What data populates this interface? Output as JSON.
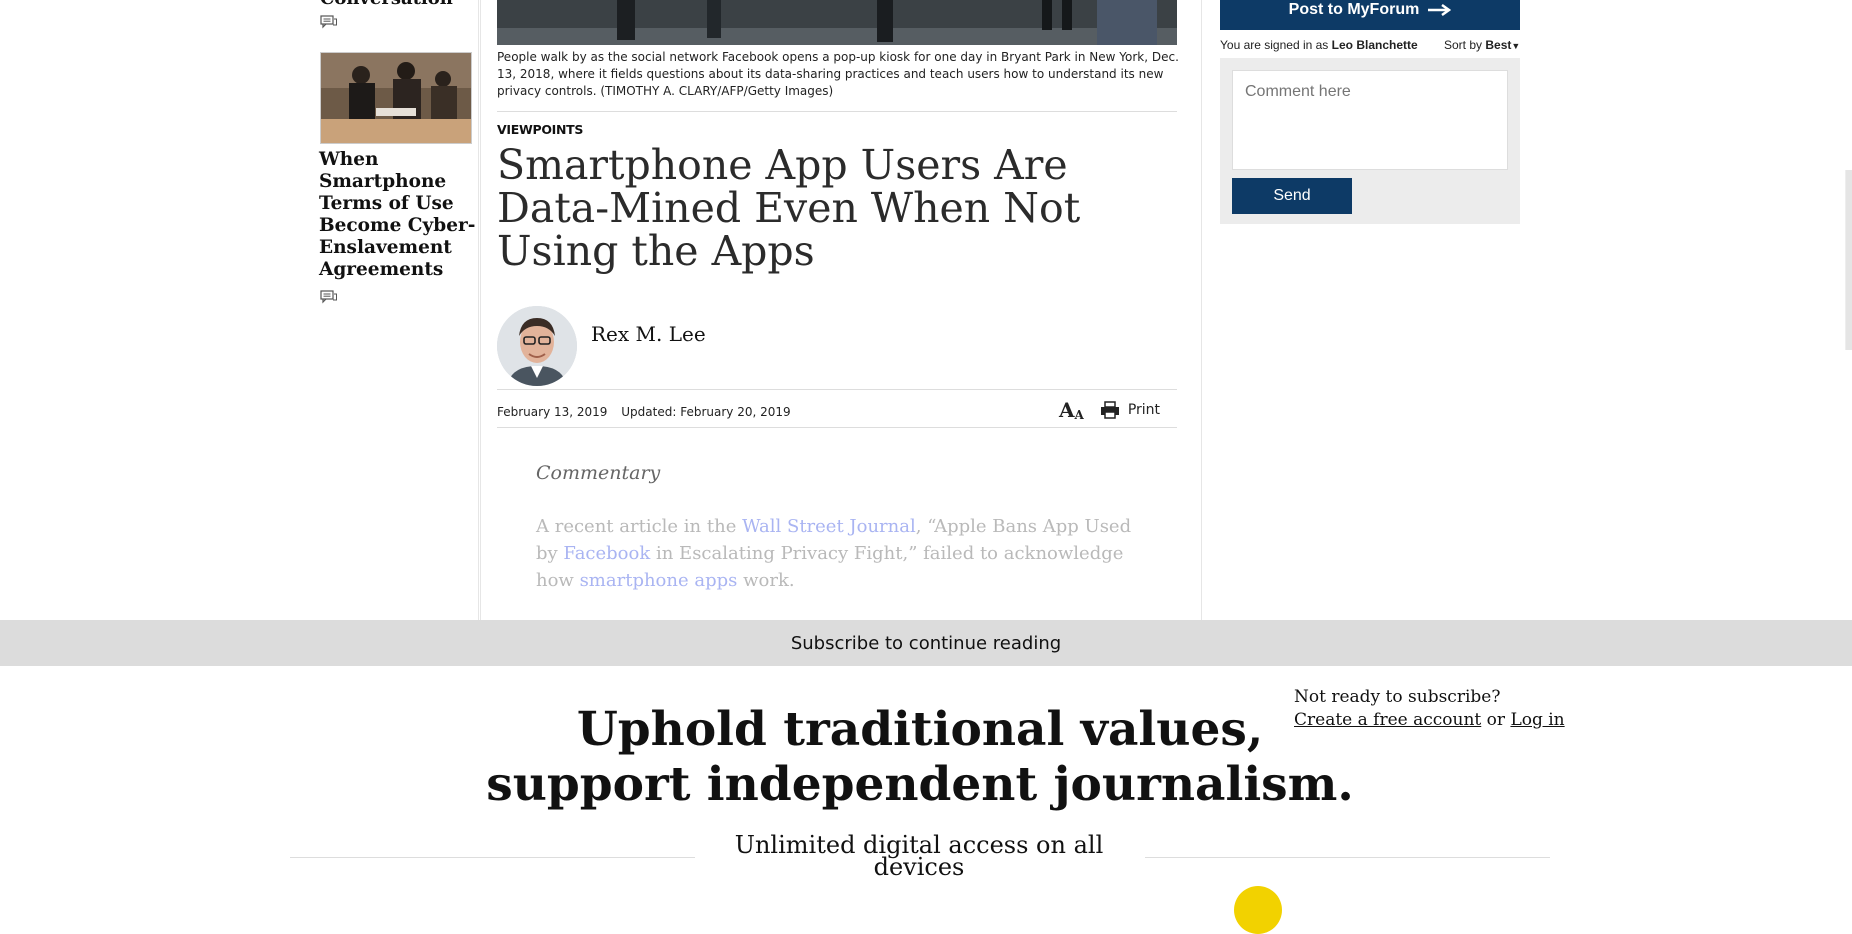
{
  "left": {
    "prev_title_fragment": "Conversation",
    "related_title": "When Smartphone Terms of Use Become Cyber-Enslavement Agreements"
  },
  "article": {
    "caption": "People walk by as the social network Facebook opens a pop-up kiosk for one day in Bryant Park in New York, Dec. 13, 2018, where it fields questions about its data-sharing practices and teach users how to understand its new privacy controls. (TIMOTHY A. CLARY/AFP/Getty Images)",
    "section": "VIEWPOINTS",
    "headline": "Smartphone App Users Are Data-Mined Even When Not Using the Apps",
    "author": "Rex M. Lee",
    "date_published": "February 13, 2019",
    "date_updated": "Updated: February 20, 2019",
    "print_label": "Print",
    "kicker": "Commentary",
    "body": {
      "p1_a": "A recent article in the ",
      "link_wsj": "Wall Street Journal",
      "p1_b": ", “Apple Bans App Used by ",
      "link_fb": "Facebook",
      "p1_c": " in Escalating Privacy Fight,” failed to acknowledge how ",
      "link_apps": "smartphone apps",
      "p1_d": " work."
    }
  },
  "sidebar": {
    "post_button": "Post to MyForum",
    "signed_prefix": "You are signed in as",
    "signed_user": "Leo Blanchette",
    "sort_prefix": "Sort by",
    "sort_value": "Best",
    "comment_placeholder": "Comment here",
    "send_label": "Send"
  },
  "paywall": {
    "bar_text": "Subscribe to continue reading",
    "headline_line1": "Uphold traditional values,",
    "headline_line2": "support independent journalism.",
    "not_ready": "Not ready to subscribe?",
    "create_account": "Create a free account",
    "or_text": "or",
    "login": "Log in",
    "sub_line1": "Unlimited digital access on all",
    "sub_line2": "devices"
  },
  "colors": {
    "brand_navy": "#0d3a66",
    "link_faded": "#a9b4f2",
    "paywall_bar": "#dcdcdc",
    "accent_yellow": "#f2d200"
  }
}
